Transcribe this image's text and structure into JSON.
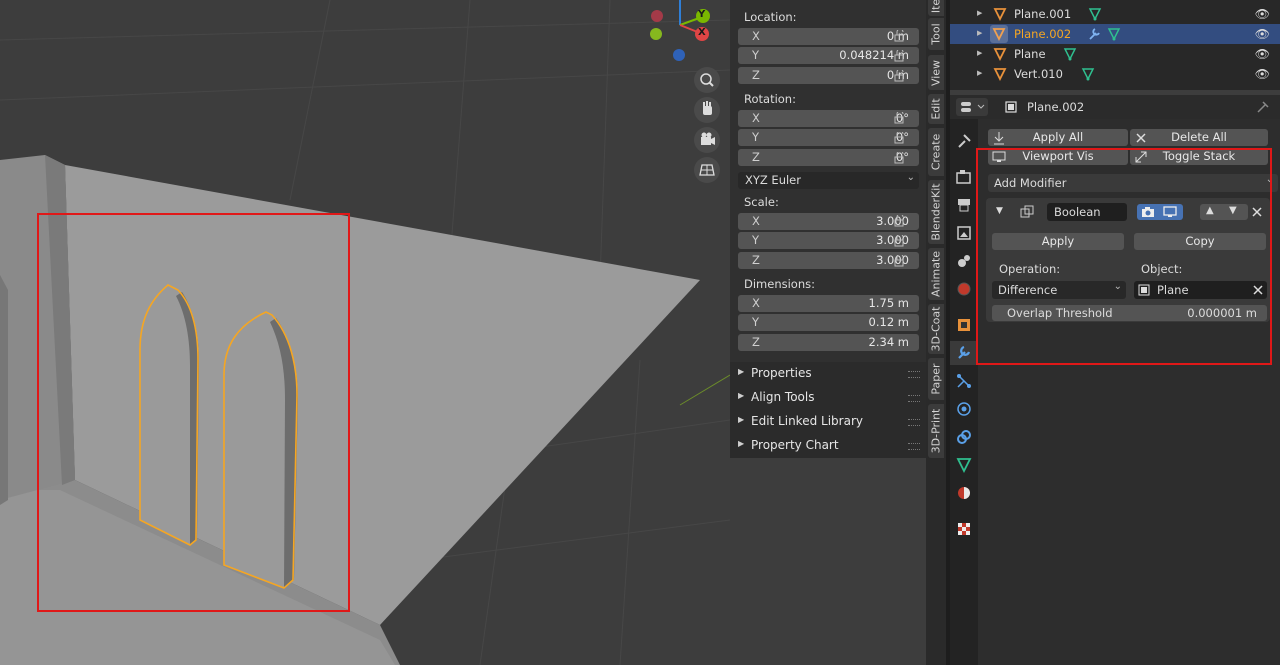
{
  "item_transform": {
    "location_label": "Location:",
    "location": [
      {
        "axis": "X",
        "value": "0 m"
      },
      {
        "axis": "Y",
        "value": "0.048214 m"
      },
      {
        "axis": "Z",
        "value": "0 m"
      }
    ],
    "rotation_label": "Rotation:",
    "rotation": [
      {
        "axis": "X",
        "value": "0°"
      },
      {
        "axis": "Y",
        "value": "0°"
      },
      {
        "axis": "Z",
        "value": "0°"
      }
    ],
    "rotation_mode": "XYZ Euler",
    "scale_label": "Scale:",
    "scale": [
      {
        "axis": "X",
        "value": "3.000"
      },
      {
        "axis": "Y",
        "value": "3.000"
      },
      {
        "axis": "Z",
        "value": "3.000"
      }
    ],
    "dimensions_label": "Dimensions:",
    "dimensions": [
      {
        "axis": "X",
        "value": "1.75 m"
      },
      {
        "axis": "Y",
        "value": "0.12 m"
      },
      {
        "axis": "Z",
        "value": "2.34 m"
      }
    ]
  },
  "collapsed_panels": [
    "Properties",
    "Align Tools",
    "Edit Linked Library",
    "Property Chart"
  ],
  "sidebar_tabs": [
    "Ite",
    "Tool",
    "View",
    "Edit",
    "Create",
    "BlenderKit",
    "Animate",
    "3D-Coat",
    "Paper",
    "3D-Print"
  ],
  "gizmo": {
    "y_label": "Y",
    "x_label": "X"
  },
  "outliner": {
    "rows": [
      {
        "name": "Plane.001",
        "selected": false
      },
      {
        "name": "Plane.002",
        "selected": true
      },
      {
        "name": "Plane",
        "selected": false
      },
      {
        "name": "Vert.010",
        "selected": false
      }
    ]
  },
  "properties": {
    "object_name": "Plane.002",
    "apply_all_label": "Apply All",
    "delete_all_label": "Delete All",
    "viewport_vis_label": "Viewport Vis",
    "toggle_stack_label": "Toggle Stack",
    "add_modifier_label": "Add Modifier",
    "modifier": {
      "name": "Boolean",
      "apply_label": "Apply",
      "copy_label": "Copy",
      "operation_label": "Operation:",
      "operation_value": "Difference",
      "object_label": "Object:",
      "object_value": "Plane",
      "overlap_label": "Overlap Threshold",
      "overlap_value": "0.000001 m"
    }
  },
  "colors": {
    "selection_orange": "#f5a623",
    "highlight_red": "#e01818",
    "selected_row": "#334d80",
    "accent_blue": "#4772b3"
  }
}
